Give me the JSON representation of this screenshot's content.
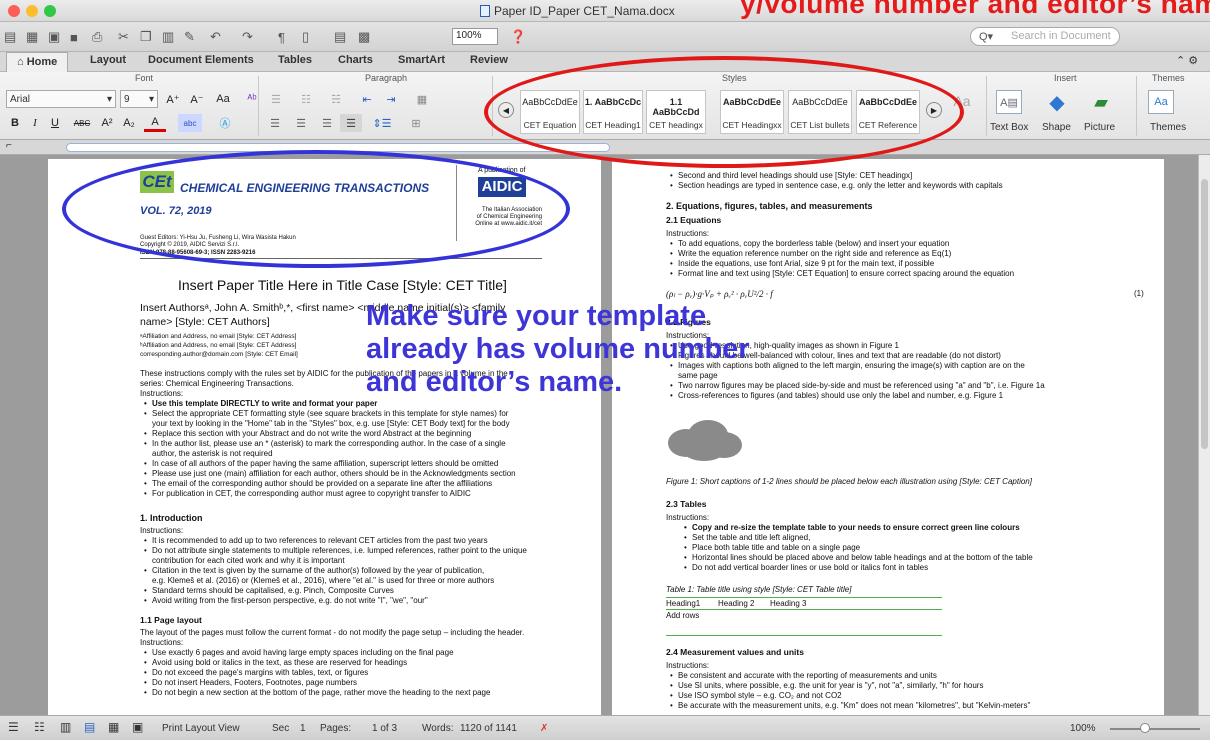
{
  "window": {
    "title": "Paper ID_Paper CET_Nama.docx",
    "top_annotation": "Make sure your template already has volume number and editor’s name.",
    "top_annotation_visible": "y/volume number and editor’s name."
  },
  "toolbar": {
    "zoom": "100%",
    "search_placeholder": "Search in Document"
  },
  "tabs": [
    "Home",
    "Layout",
    "Document Elements",
    "Tables",
    "Charts",
    "SmartArt",
    "Review"
  ],
  "ribbon": {
    "font_label": "Font",
    "paragraph_label": "Paragraph",
    "styles_label": "Styles",
    "insert_label": "Insert",
    "themes_label": "Themes",
    "font_name": "Arial",
    "font_size": "9",
    "styles": [
      {
        "preview": "AaBbCcDdEe",
        "name": "CET Equation"
      },
      {
        "preview": "1. AaBbCcDc",
        "name": "CET Heading1"
      },
      {
        "preview": "1.1 AaBbCcDd",
        "name": "CET headingx"
      },
      {
        "preview": "AaBbCcDdEe",
        "name": "CET Headingxx"
      },
      {
        "preview": "AaBbCcDdEe",
        "name": "CET List bullets"
      },
      {
        "preview": "AaBbCcDdEe",
        "name": "CET Reference"
      }
    ],
    "insert_items": [
      "Text Box",
      "Shape",
      "Picture"
    ],
    "themes_item": "Themes"
  },
  "left_page": {
    "journal_name": "CHEMICAL ENGINEERING TRANSACTIONS",
    "cet_logo": "CEt",
    "volume": "VOL. 72, 2019",
    "publication_of": "A publication of",
    "aidic": "AIDIC",
    "aidic_sub": [
      "The Italian Association",
      "of Chemical Engineering",
      "Online at www.aidic.it/cet"
    ],
    "editors": "Guest Editors: Yi-Hsu Ju, Fusheng Li, Wira Wasista Hakun",
    "copyright": "Copyright © 2019, AIDIC Servizi S.r.l.",
    "isbn": "ISBN 978-88-95608-69-3; ISSN 2283-9216",
    "paper_title": "Insert Paper Title Here in Title Case [Style: CET Title]",
    "authors_1": "Insert Authorsᵃ, John A. Smithᵇ,*, <first name> <middle name initial(s)> <family",
    "authors_2": "name> [Style: CET Authors]",
    "affil": [
      "ᵃAffiliation and Address, no email [Style: CET Address]",
      "ᵇAffiliation and Address, no email [Style: CET Address]",
      " corresponding.author@domain.com [Style: CET Email]"
    ],
    "intro_1": "These instructions comply with the rules set by AIDIC for the publication of the papers in a volume in the",
    "intro_2": "series: Chemical Engineering Transactions.",
    "instructions": "Instructions:",
    "abstract_bullets": [
      "Use this template DIRECTLY to write and format your paper",
      "Select the appropriate CET formatting style (see square brackets in this template for style names) for",
      "your text by looking in the \"Home\" tab in the \"Styles\" box, e.g. use [Style: CET Body text] for the body",
      "Replace this section with your Abstract and do not write the word Abstract at the beginning",
      "In the author list, please use an * (asterisk) to mark the corresponding author. In the case of a single",
      "author, the asterisk is not required",
      "In case of all authors of the paper having the same affiliation, superscript letters should be omitted",
      "Please use just one (main) affiliation for each author, others should be in the Acknowledgments section",
      "The email of the corresponding author should be provided on a separate line after the affiliations",
      "For publication in CET, the corresponding author must agree to copyright transfer to AIDIC"
    ],
    "h_intro": "1. Introduction",
    "intro_bullets": [
      "It is recommended to add up to two references to relevant CET articles from the past two years",
      "Do not attribute single statements to multiple references, i.e. lumped references, rather point to the unique",
      "contribution for each cited work and why it is important",
      "Citation in the text is given by the surname of the author(s) followed by the year of publication,",
      "e.g. Klemeš et al. (2016) or (Klemeš et al., 2016), where \"et al.\" is used for three or more authors",
      "Standard terms should be capitalised, e.g. Pinch, Composite Curves",
      "Avoid writing from the first-person perspective, e.g. do not write \"I\", \"we\", \"our\""
    ],
    "h_layout": "1.1 Page layout",
    "layout_text": "The layout of the pages must follow the current format - do not modify the page setup – including the header.",
    "layout_bullets": [
      "Use exactly 6 pages and avoid having large empty spaces including on the final page",
      "Avoid using bold or italics in the text, as these are reserved for headings",
      "Do not exceed the page's margins with tables, text, or figures",
      "Do not insert Headers, Footers, Footnotes, page numbers",
      "Do not begin a new section at the bottom of the page, rather move the heading to the next page"
    ]
  },
  "right_page": {
    "top_bullets": [
      "Second and third level headings should use [Style: CET headingx]",
      "Section headings are typed in sentence case, e.g. only the letter and keywords with capitals"
    ],
    "h2": "2. Equations, figures, tables, and measurements",
    "h21": "2.1 Equations",
    "instructions": "Instructions:",
    "eq_bullets": [
      "To add equations, copy the borderless table (below) and insert your equation",
      "Write the equation reference number on the right side and reference as Eq(1)",
      "Inside the equations, use font Arial, size 9 pt for the main text, if possible",
      "Format line and text using [Style: CET Equation] to ensure correct spacing around the equation"
    ],
    "equation": "(ρₗ − ρᵥ)·g·Vₚ + ρᵥ² · ρᵥU²/2 · f",
    "eq_num": "(1)",
    "h22": "2.2 Figures",
    "fig_bullets": [
      "Use good-resolution, high-quality images as shown in Figure 1",
      "Figures should be well-balanced with colour, lines and text that are readable (do not distort)",
      "Images with captions both aligned to the left margin, ensuring the image(s) with caption are on the",
      "same page",
      "Two narrow figures may be placed side-by-side and must be referenced using \"a\" and \"b\", i.e. Figure 1a",
      "Cross-references to figures (and tables) should use only the label and number, e.g. Figure 1"
    ],
    "fig_caption": "Figure 1: Short captions of 1-2 lines should be placed below each illustration using [Style: CET Caption]",
    "h23": "2.3 Tables",
    "tab_bullets": [
      "Copy and re-size the template table to your needs to ensure correct green line colours",
      "Set the table and title left aligned,",
      "Place both table title and table on a single page",
      "Horizontal lines should be placed above and below table headings and at the bottom of the table",
      "Do not add vertical boarder lines or use bold or italics font in tables"
    ],
    "table_title": "Table 1: Table title using style [Style: CET Table title]",
    "table_headers": [
      "Heading1",
      "Heading 2",
      "Heading 3"
    ],
    "table_row": "Add rows",
    "h24": "2.4 Measurement values and units",
    "meas_bullets": [
      "Be consistent and accurate with the reporting of measurements and units",
      "Use SI units, where possible, e.g. the unit for year is \"y\", not \"a\", similarly, \"h\" for hours",
      "Use ISO symbol style – e.g. CO₂ and not CO2",
      "Be accurate with the measurement units, e.g. \"Km\" does not mean \"kilometres\", but \"Kelvin-meters\""
    ]
  },
  "overlay": [
    "Make sure your template",
    "already has volume number",
    "and editor’s name."
  ],
  "status": {
    "view": "Print Layout View",
    "sec": "Sec",
    "sec_num": "1",
    "pages_label": "Pages:",
    "pages": "1 of 3",
    "words_label": "Words:",
    "words": "1120 of 1141",
    "zoom": "100%"
  },
  "colors": {
    "red_annotation": "#e01818",
    "blue_annotation": "#3433d8",
    "cet_green": "#8bc34a",
    "cet_blue": "#1f3f99"
  }
}
